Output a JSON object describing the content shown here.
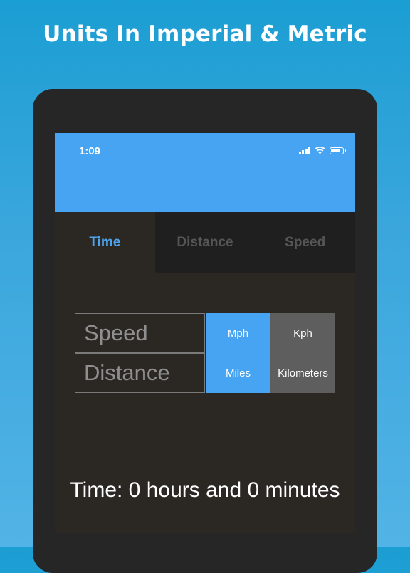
{
  "headline": "Units In Imperial & Metric",
  "status_bar": {
    "time": "1:09"
  },
  "tabs": [
    {
      "label": "Time",
      "active": true
    },
    {
      "label": "Distance",
      "active": false
    },
    {
      "label": "Speed",
      "active": false
    }
  ],
  "units": {
    "rows": [
      {
        "label": "Speed",
        "imperial": "Mph",
        "metric": "Kph"
      },
      {
        "label": "Distance",
        "imperial": "Miles",
        "metric": "Kilometers"
      }
    ],
    "selected": "imperial"
  },
  "result_text": "Time: 0 hours and 0 minutes",
  "colors": {
    "accent": "#47a4f2",
    "metric_option": "#5e5e5e",
    "screen_bg": "#2b2824",
    "tabbar_bg": "#1f1f1f"
  }
}
